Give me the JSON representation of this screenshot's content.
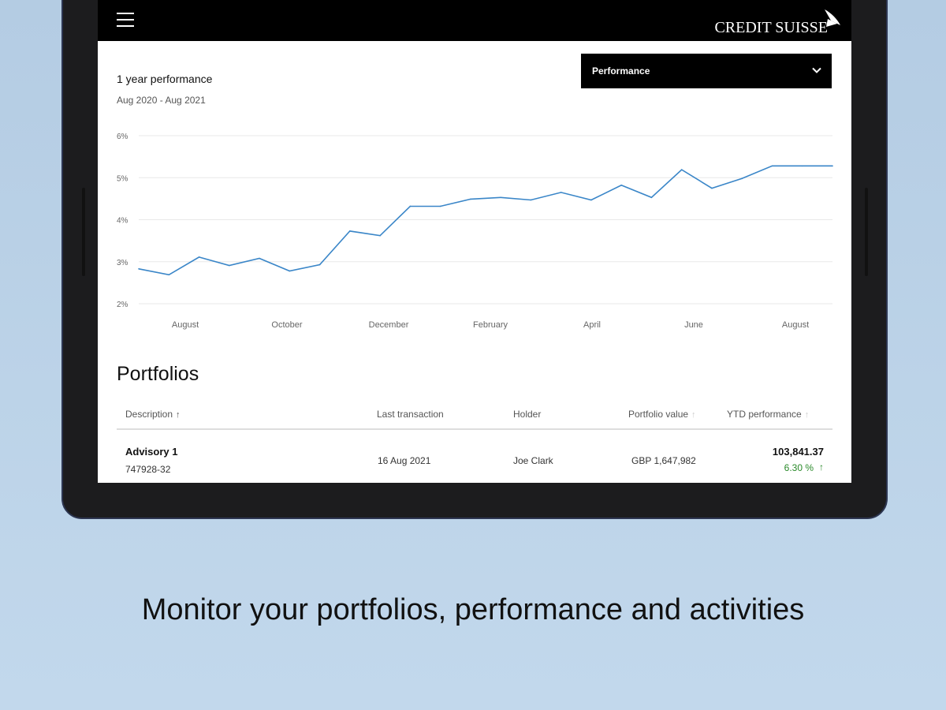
{
  "app": {
    "brand": "CREDIT SUISSE"
  },
  "performance": {
    "title": "1 year performance",
    "range": "Aug 2020 - Aug 2021",
    "dropdown_selected": "Performance"
  },
  "chart_data": {
    "type": "line",
    "y_ticks": [
      "6%",
      "5%",
      "4%",
      "3%",
      "2%"
    ],
    "ylim": [
      2,
      6
    ],
    "x_tick_labels": [
      "August",
      "October",
      "December",
      "February",
      "April",
      "June",
      "August"
    ],
    "series": [
      {
        "values": [
          2.83,
          2.69,
          3.11,
          2.91,
          3.08,
          2.78,
          2.93,
          3.73,
          3.62,
          4.32,
          4.32,
          4.49,
          4.53,
          4.47,
          4.65,
          4.47,
          4.82,
          4.53,
          5.19,
          4.75,
          4.98,
          5.28,
          5.28,
          5.28
        ]
      }
    ],
    "color": "#3a86c8"
  },
  "portfolios": {
    "title": "Portfolios",
    "columns": {
      "description": "Description",
      "last_transaction": "Last transaction",
      "holder": "Holder",
      "portfolio_value": "Portfolio value",
      "ytd_performance": "YTD performance"
    },
    "sort_up_arrow": "↑",
    "rows": [
      {
        "name": "Advisory 1",
        "number": "747928-32",
        "last_transaction": "16 Aug 2021",
        "holder": "Joe Clark",
        "portfolio_value": "GBP 1,647,982",
        "ytd_value": "103,841.37",
        "ytd_percent": "6.30 %",
        "ytd_arrow": "↑"
      }
    ]
  },
  "caption": "Monitor your portfolios, performance and activities"
}
